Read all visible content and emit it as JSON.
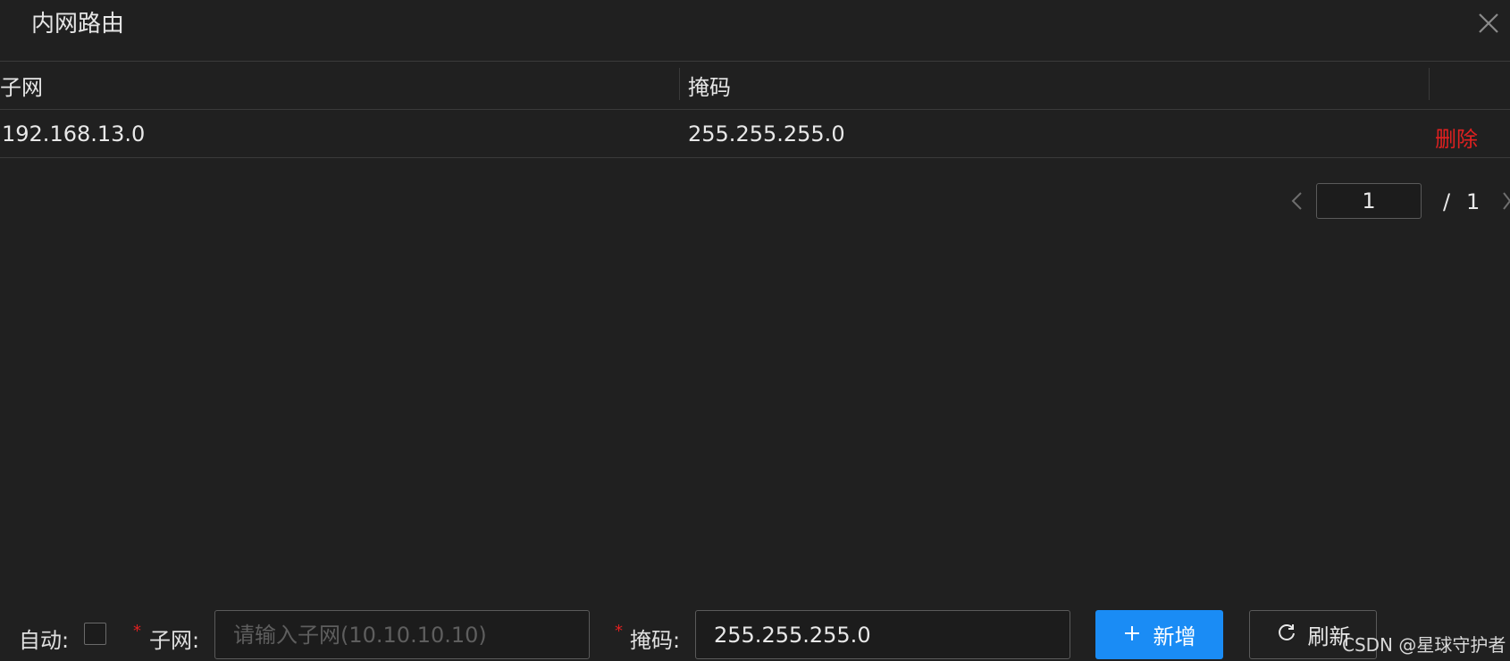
{
  "dialog": {
    "title": "内网路由",
    "close_icon": "close-icon"
  },
  "table": {
    "columns": [
      "子网",
      "掩码",
      ""
    ],
    "rows": [
      {
        "subnet": "192.168.13.0",
        "mask": "255.255.255.0",
        "action": "删除"
      }
    ]
  },
  "pagination": {
    "current_page": "1",
    "separator": "/",
    "total_pages": "1",
    "prev_icon": "chevron-left-icon",
    "next_icon": "chevron-right-icon"
  },
  "form": {
    "auto_label": "自动:",
    "auto_checked": false,
    "required_mark": "*",
    "subnet_label": "子网:",
    "subnet_value": "",
    "subnet_placeholder": "请输入子网(10.10.10.10)",
    "mask_label": "掩码:",
    "mask_value": "255.255.255.0",
    "add_button": "新增",
    "add_icon": "plus-icon",
    "refresh_button": "刷新",
    "refresh_icon": "refresh-icon"
  },
  "watermark": "CSDN @星球守护者",
  "colors": {
    "background": "#202020",
    "primary": "#1a8cf5",
    "danger": "#e02020",
    "border": "#3a3a3a"
  }
}
